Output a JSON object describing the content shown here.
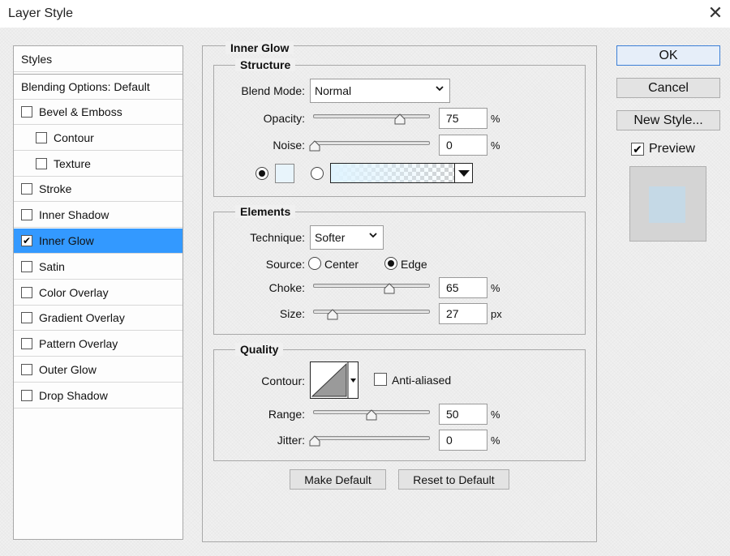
{
  "window": {
    "title": "Layer Style",
    "close_glyph": "✕"
  },
  "sidebar": {
    "header_styles": "Styles",
    "header_blending": "Blending Options: Default",
    "items": [
      {
        "label": "Bevel & Emboss",
        "checked": false,
        "indent": false
      },
      {
        "label": "Contour",
        "checked": false,
        "indent": true
      },
      {
        "label": "Texture",
        "checked": false,
        "indent": true
      },
      {
        "label": "Stroke",
        "checked": false,
        "indent": false
      },
      {
        "label": "Inner Shadow",
        "checked": false,
        "indent": false
      },
      {
        "label": "Inner Glow",
        "checked": true,
        "indent": false,
        "selected": true
      },
      {
        "label": "Satin",
        "checked": false,
        "indent": false
      },
      {
        "label": "Color Overlay",
        "checked": false,
        "indent": false
      },
      {
        "label": "Gradient Overlay",
        "checked": false,
        "indent": false
      },
      {
        "label": "Pattern Overlay",
        "checked": false,
        "indent": false
      },
      {
        "label": "Outer Glow",
        "checked": false,
        "indent": false
      },
      {
        "label": "Drop Shadow",
        "checked": false,
        "indent": false
      }
    ]
  },
  "panel": {
    "title": "Inner Glow",
    "structure": {
      "title": "Structure",
      "blend_mode_label": "Blend Mode:",
      "blend_mode_value": "Normal",
      "opacity_label": "Opacity:",
      "opacity_value": "75",
      "opacity_unit": "%",
      "noise_label": "Noise:",
      "noise_value": "0",
      "noise_unit": "%",
      "glow_color": "#e8f4fb"
    },
    "elements": {
      "title": "Elements",
      "technique_label": "Technique:",
      "technique_value": "Softer",
      "source_label": "Source:",
      "source_center": "Center",
      "source_edge": "Edge",
      "choke_label": "Choke:",
      "choke_value": "65",
      "choke_unit": "%",
      "size_label": "Size:",
      "size_value": "27",
      "size_unit": "px"
    },
    "quality": {
      "title": "Quality",
      "contour_label": "Contour:",
      "anti_aliased_label": "Anti-aliased",
      "range_label": "Range:",
      "range_value": "50",
      "range_unit": "%",
      "jitter_label": "Jitter:",
      "jitter_value": "0",
      "jitter_unit": "%"
    },
    "make_default": "Make Default",
    "reset_default": "Reset to Default"
  },
  "actions": {
    "ok": "OK",
    "cancel": "Cancel",
    "new_style": "New Style...",
    "preview_label": "Preview",
    "preview_checked": true
  },
  "colors": {
    "selection": "#3399ff",
    "preview_inner": "#c5d9e6",
    "preview_bg": "#d4d4d4"
  }
}
